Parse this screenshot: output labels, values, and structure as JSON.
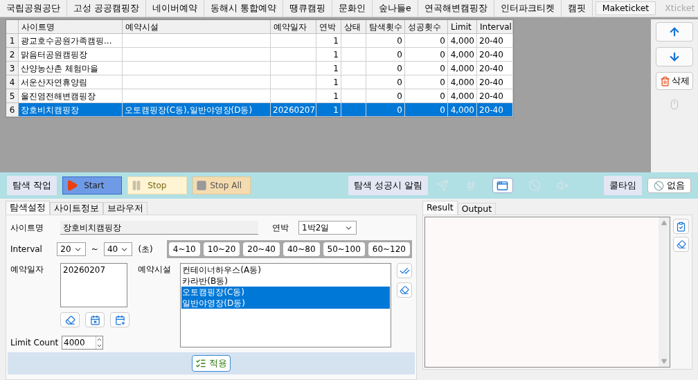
{
  "site_tabs": [
    {
      "label": "국립공원공단",
      "selected": false,
      "disabled": false
    },
    {
      "label": "고성 공공캠핑장",
      "selected": false,
      "disabled": false
    },
    {
      "label": "네이버예약",
      "selected": false,
      "disabled": false
    },
    {
      "label": "동해시 통합예약",
      "selected": false,
      "disabled": false
    },
    {
      "label": "땡큐캠핑",
      "selected": false,
      "disabled": false
    },
    {
      "label": "문화인",
      "selected": false,
      "disabled": false
    },
    {
      "label": "숲나들e",
      "selected": false,
      "disabled": false
    },
    {
      "label": "연곡해변캠핑장",
      "selected": false,
      "disabled": false
    },
    {
      "label": "인터파크티켓",
      "selected": false,
      "disabled": false
    },
    {
      "label": "캠핏",
      "selected": false,
      "disabled": false
    },
    {
      "label": "Maketicket",
      "selected": true,
      "disabled": false
    },
    {
      "label": "Xticket",
      "selected": false,
      "disabled": true
    }
  ],
  "table": {
    "columns": [
      "사이트명",
      "예약시설",
      "예약일자",
      "연박",
      "상태",
      "탐색횟수",
      "성공횟수",
      "Limit",
      "Interval"
    ],
    "rows": [
      {
        "index": "1",
        "cells": [
          "광교호수공원가족캠핑...",
          "",
          "",
          "1",
          "",
          "0",
          "0",
          "4,000",
          "20-40"
        ],
        "selected": false
      },
      {
        "index": "2",
        "cells": [
          "맑음터공원캠핑장",
          "",
          "",
          "1",
          "",
          "0",
          "0",
          "4,000",
          "20-40"
        ],
        "selected": false
      },
      {
        "index": "3",
        "cells": [
          "산양농산촌 체험마을",
          "",
          "",
          "1",
          "",
          "0",
          "0",
          "4,000",
          "20-40"
        ],
        "selected": false
      },
      {
        "index": "4",
        "cells": [
          "서운산자연휴양림",
          "",
          "",
          "1",
          "",
          "0",
          "0",
          "4,000",
          "20-40"
        ],
        "selected": false
      },
      {
        "index": "5",
        "cells": [
          "울진염전해변캠핑장",
          "",
          "",
          "1",
          "",
          "0",
          "0",
          "4,000",
          "20-40"
        ],
        "selected": false
      },
      {
        "index": "6",
        "cells": [
          "장호비치캠핑장",
          "오토캠핑장(C동),일반야영장(D동)",
          "20260207",
          "1",
          "",
          "0",
          "0",
          "4,000",
          "20-40"
        ],
        "selected": true
      }
    ]
  },
  "side_buttons": [
    {
      "kind": "up"
    },
    {
      "kind": "down"
    },
    {
      "kind": "delete",
      "label": "삭제"
    },
    {
      "kind": "mouse",
      "disabled": true
    }
  ],
  "toolbar": {
    "task_label": "탐색 작업",
    "start": "Start",
    "stop": "Stop",
    "stop_all": "Stop All",
    "alert_label": "탐색 성공시 알림",
    "alert_icons": [
      {
        "kind": "send",
        "disabled": true
      },
      {
        "kind": "hash",
        "disabled": true
      },
      {
        "kind": "window",
        "disabled": false
      },
      {
        "kind": "ban",
        "disabled": true
      },
      {
        "kind": "mute",
        "disabled": true
      }
    ],
    "cooltime_label": "쿨타임",
    "cooltime_value": "없음"
  },
  "settings": {
    "tabs": [
      {
        "label": "탐색설정",
        "selected": true
      },
      {
        "label": "사이트정보",
        "selected": false
      },
      {
        "label": "브라우저",
        "selected": false
      }
    ],
    "site_name_label": "사이트명",
    "site_name": "장호비치캠핑장",
    "nights_label": "연박",
    "nights": "1박2일",
    "interval_label": "Interval",
    "interval_min": "20",
    "interval_sep": "~",
    "interval_max": "40",
    "interval_unit": "(초)",
    "presets": [
      "4~10",
      "10~20",
      "20~40",
      "40~80",
      "50~100",
      "60~120"
    ],
    "date_label": "예약일자",
    "dates": [
      "20260207"
    ],
    "facility_label": "예약시설",
    "facilities": [
      {
        "label": "컨테이너하우스(A동)",
        "selected": false
      },
      {
        "label": "카라반(B동)",
        "selected": false
      },
      {
        "label": "오토캠핑장(C동)",
        "selected": true
      },
      {
        "label": "일반야영장(D동)",
        "selected": true
      }
    ],
    "limit_label": "Limit Count",
    "limit": "4000",
    "apply": "적용"
  },
  "output": {
    "tabs": [
      {
        "label": "Result",
        "selected": true
      },
      {
        "label": "Output",
        "selected": false
      }
    ]
  }
}
